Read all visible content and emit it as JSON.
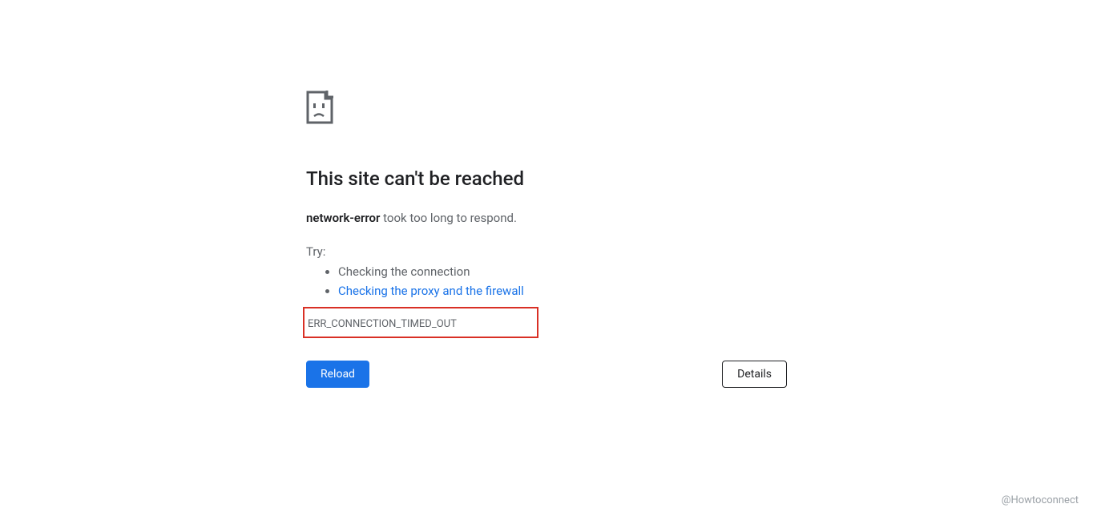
{
  "error": {
    "heading": "This site can't be reached",
    "hostname": "network-error",
    "message_suffix": " took too long to respond.",
    "try_label": "Try:",
    "suggestions": {
      "check_connection": "Checking the connection",
      "check_proxy_firewall": "Checking the proxy and the firewall"
    },
    "error_code": "ERR_CONNECTION_TIMED_OUT"
  },
  "buttons": {
    "reload": "Reload",
    "details": "Details"
  },
  "watermark": "@Howtoconnect"
}
